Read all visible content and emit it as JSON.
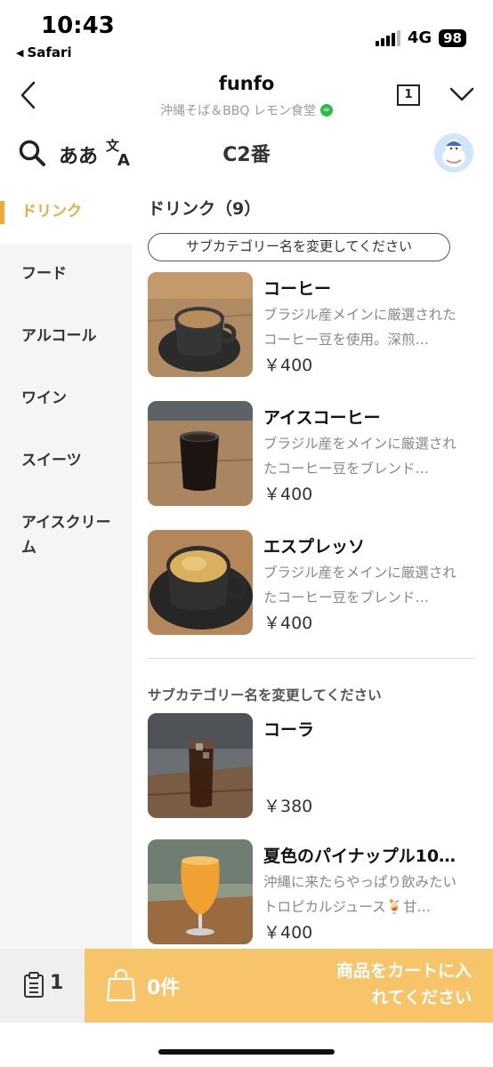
{
  "status_bar": {
    "time": "10:43",
    "back_app": "Safari",
    "network": "4G",
    "battery": "98"
  },
  "header": {
    "title": "funfo",
    "subtitle": "沖縄そば＆BBQ レモン食堂",
    "page_count": "1"
  },
  "toolbar": {
    "kana_toggle": "ああ",
    "table_label": "C2番"
  },
  "sidebar": {
    "items": [
      {
        "label": "ドリンク",
        "active": true
      },
      {
        "label": "フード"
      },
      {
        "label": "アルコール"
      },
      {
        "label": "ワイン"
      },
      {
        "label": "スイーツ"
      },
      {
        "label": "アイスクリーム"
      }
    ]
  },
  "main": {
    "section_title": "ドリンク（9）",
    "subcategory_pill": "サブカテゴリー名を変更してください",
    "subcategory_title2": "サブカテゴリー名を変更してください",
    "items": [
      {
        "name": "コーヒー",
        "desc": "ブラジル産メインに厳選されたコーヒー豆を使用。深煎…",
        "price": "￥400"
      },
      {
        "name": "アイスコーヒー",
        "desc": "ブラジル産をメインに厳選されたコーヒー豆をブレンド…",
        "price": "￥400"
      },
      {
        "name": "エスプレッソ",
        "desc": "ブラジル産をメインに厳選されたコーヒー豆をブレンド…",
        "price": "￥400"
      },
      {
        "name": "コーラ",
        "desc": "",
        "price": "￥380"
      },
      {
        "name": "夏色のパイナップル10…",
        "desc": "沖縄に来たらやっぱり飲みたいトロピカルジュース🍹甘…",
        "price": "￥400"
      }
    ]
  },
  "bottom_bar": {
    "order_count": "1",
    "cart_count": "0件",
    "cart_message": "商品をカートに入れてください"
  },
  "colors": {
    "accent": "#f0a93a",
    "cart_bg": "#f7c46a",
    "sidebar_bg": "#f5f5f5"
  }
}
